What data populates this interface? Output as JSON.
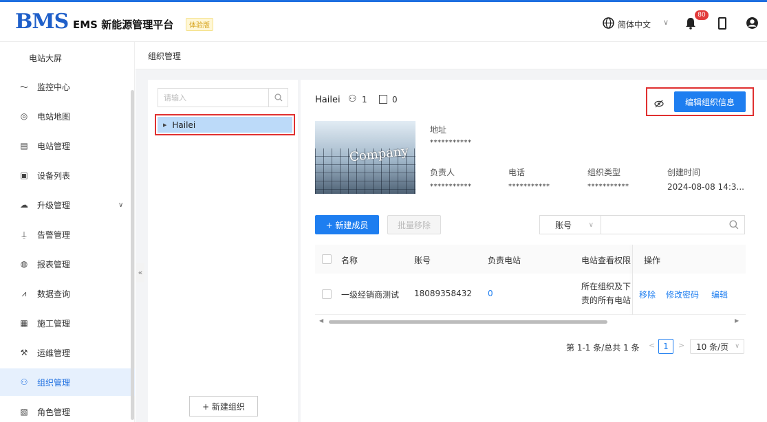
{
  "header": {
    "logo": "BMS",
    "title": "EMS 新能源管理平台",
    "badge": "体验版",
    "language": "简体中文",
    "notification_count": "80"
  },
  "sidebar": {
    "items": [
      {
        "label": "电站大屏",
        "icon": ""
      },
      {
        "label": "监控中心",
        "icon": "activity-icon"
      },
      {
        "label": "电站地图",
        "icon": "map-pin-icon"
      },
      {
        "label": "电站管理",
        "icon": "station-icon"
      },
      {
        "label": "设备列表",
        "icon": "device-icon"
      },
      {
        "label": "升级管理",
        "icon": "cloud-upload-icon"
      },
      {
        "label": "告警管理",
        "icon": "alarm-icon"
      },
      {
        "label": "报表管理",
        "icon": "report-icon"
      },
      {
        "label": "数据查询",
        "icon": "chart-icon"
      },
      {
        "label": "施工管理",
        "icon": "construction-icon"
      },
      {
        "label": "运维管理",
        "icon": "wrench-icon"
      },
      {
        "label": "组织管理",
        "icon": "org-icon"
      },
      {
        "label": "角色管理",
        "icon": "role-icon"
      }
    ],
    "active": "组织管理"
  },
  "breadcrumb": "组织管理",
  "tree": {
    "search_placeholder": "请输入",
    "node": "Hailei",
    "new_org_label": "+ 新建组织"
  },
  "org": {
    "name": "Hailei",
    "member_count": "1",
    "station_count": "0",
    "edit_label": "编辑组织信息",
    "photo_text": "Company",
    "address_label": "地址",
    "address_value": "***********",
    "owner_label": "负责人",
    "owner_value": "***********",
    "phone_label": "电话",
    "phone_value": "***********",
    "type_label": "组织类型",
    "type_value": "***********",
    "created_label": "创建时间",
    "created_value": "2024-08-08 14:3..."
  },
  "members": {
    "new_label": "+ 新建成员",
    "batch_remove_label": "批量移除",
    "filter_field": "账号",
    "filter_value": "",
    "columns": [
      "名称",
      "账号",
      "负责电站",
      "电站查看权限",
      "操作"
    ],
    "rows": [
      {
        "name": "一级经销商测试",
        "account": "18089358432",
        "stations": "0",
        "permission_line1": "所在组织及下",
        "permission_line2": "责的所有电站",
        "actions": [
          "移除",
          "修改密码",
          "编辑"
        ]
      }
    ]
  },
  "pagination": {
    "total": "第 1-1 条/总共 1 条",
    "current": "1",
    "page_size": "10 条/页"
  },
  "colors": {
    "primary": "#1e7ef0",
    "logo": "#1f5fc9",
    "highlight": "#e03030",
    "selected_bg": "#bcdaf9"
  }
}
